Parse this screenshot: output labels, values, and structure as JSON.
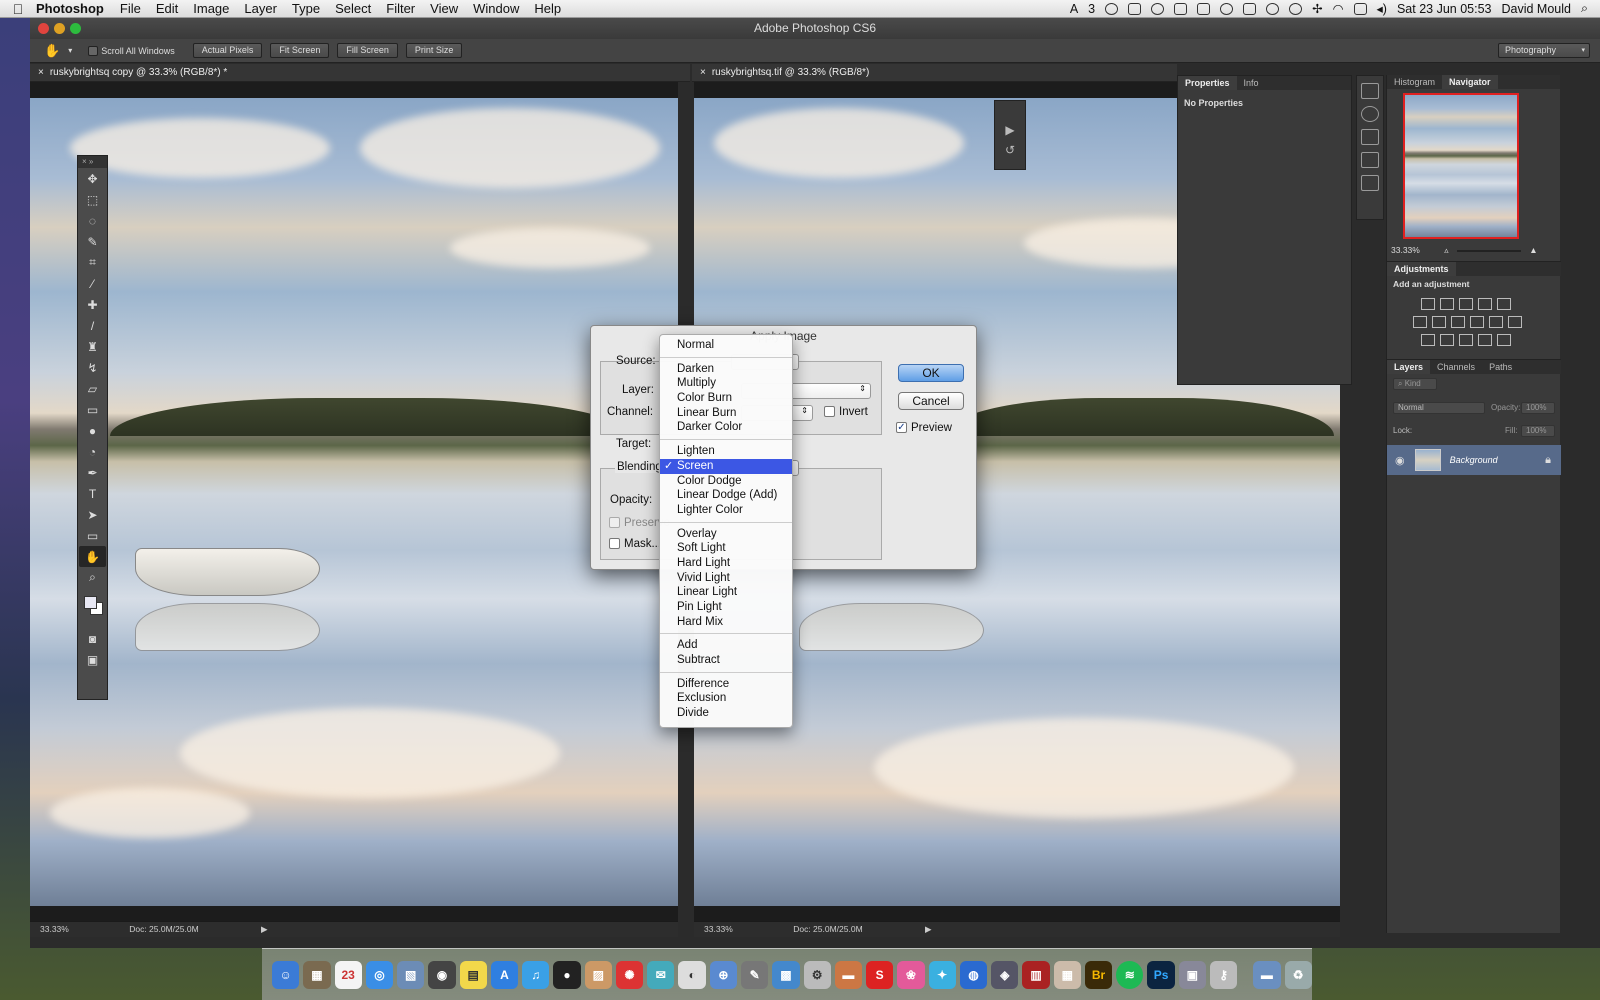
{
  "menubar": {
    "app_name": "Photoshop",
    "items": [
      "File",
      "Edit",
      "Image",
      "Layer",
      "Type",
      "Select",
      "Filter",
      "View",
      "Window",
      "Help"
    ],
    "status_badge": "3",
    "clock": "Sat 23 Jun  05:53",
    "user": "David Mould"
  },
  "window": {
    "title": "Adobe Photoshop CS6"
  },
  "options_bar": {
    "scroll_all_windows": "Scroll All Windows",
    "buttons": [
      "Actual Pixels",
      "Fit Screen",
      "Fill Screen",
      "Print Size"
    ],
    "workspace": "Photography"
  },
  "documents": [
    {
      "tab": "ruskybrightsq copy @ 33.3% (RGB/8*) *",
      "zoom": "33.33%",
      "doc_size": "Doc: 25.0M/25.0M"
    },
    {
      "tab": "ruskybrightsq.tif @ 33.3% (RGB/8*)",
      "zoom": "33.33%",
      "doc_size": "Doc: 25.0M/25.0M"
    }
  ],
  "properties_panel": {
    "tabs": [
      "Properties",
      "Info"
    ],
    "content": "No Properties"
  },
  "navigator_panel": {
    "tabs": [
      "Histogram",
      "Navigator"
    ],
    "zoom": "33.33%"
  },
  "adjustments_panel": {
    "title": "Adjustments",
    "subtitle": "Add an adjustment"
  },
  "layers_panel": {
    "tabs": [
      "Layers",
      "Channels",
      "Paths"
    ],
    "filter": "Kind",
    "blend_mode": "Normal",
    "opacity_label": "Opacity:",
    "opacity_value": "100%",
    "lock_label": "Lock:",
    "fill_label": "Fill:",
    "fill_value": "100%",
    "layer_name": "Background"
  },
  "dialog": {
    "title": "Apply Image",
    "source_label": "Source:",
    "layer_label": "Layer:",
    "channel_label": "Channel:",
    "invert_label": "Invert",
    "target_label": "Target:",
    "blending_label": "Blending",
    "opacity_label": "Opacity:",
    "preserve_label": "Preserve",
    "mask_label": "Mask...",
    "ok_label": "OK",
    "cancel_label": "Cancel",
    "preview_label": "Preview"
  },
  "blend_menu": {
    "selected": "Screen",
    "groups": [
      [
        "Normal"
      ],
      [
        "Darken",
        "Multiply",
        "Color Burn",
        "Linear Burn",
        "Darker Color"
      ],
      [
        "Lighten",
        "Screen",
        "Color Dodge",
        "Linear Dodge (Add)",
        "Lighter Color"
      ],
      [
        "Overlay",
        "Soft Light",
        "Hard Light",
        "Vivid Light",
        "Linear Light",
        "Pin Light",
        "Hard Mix"
      ],
      [
        "Add",
        "Subtract"
      ],
      [
        "Difference",
        "Exclusion",
        "Divide"
      ]
    ]
  },
  "dock": {
    "calendar_day": "23",
    "br_label": "Br",
    "ps_label": "Ps"
  },
  "colors": {
    "selection_blue": "#3c57e4",
    "navigator_box": "#e02020",
    "layer_selected": "#576a8a"
  }
}
